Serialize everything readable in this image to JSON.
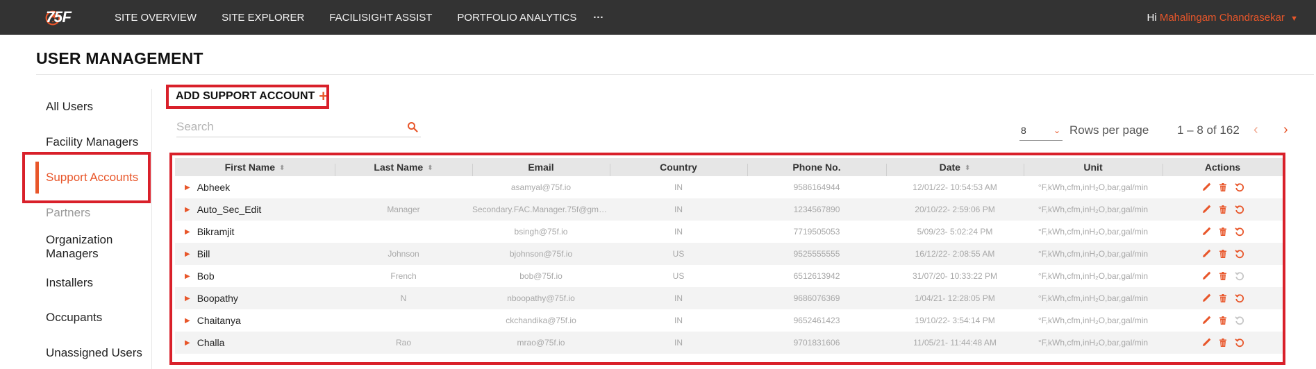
{
  "app": {
    "brand": "75F",
    "nav": [
      "SITE OVERVIEW",
      "SITE EXPLORER",
      "FACILISIGHT ASSIST",
      "PORTFOLIO ANALYTICS"
    ],
    "more": "···",
    "greeting": "Hi",
    "user_name": "Mahalingam Chandrasekar"
  },
  "page": {
    "title": "USER MANAGEMENT"
  },
  "sidebar": {
    "items": [
      "All Users",
      "Facility Managers",
      "Support Accounts",
      "Partners",
      "Organization Managers",
      "Installers",
      "Occupants",
      "Unassigned Users"
    ],
    "active": "Support Accounts"
  },
  "toolbar": {
    "add_label": "ADD SUPPORT ACCOUNT",
    "add_icon": "+",
    "search_placeholder": "Search",
    "rows_value": "8",
    "rows_label": "Rows per page",
    "range_text": "1 – 8 of 162"
  },
  "table": {
    "headers": [
      "First Name",
      "Last Name",
      "Email",
      "Country",
      "Phone No.",
      "Date",
      "Unit",
      "Actions"
    ],
    "rows": [
      {
        "first": "Abheek",
        "last": "",
        "email": "asamyal@75f.io",
        "country": "IN",
        "phone": "9586164944",
        "date": "12/01/22- 10:54:53 AM",
        "unit": "°F,kWh,cfm,inH₂O,bar,gal/min",
        "reset_dim": false
      },
      {
        "first": "Auto_Sec_Edit",
        "last": "Manager",
        "email": "Secondary.FAC.Manager.75f@gma...",
        "country": "IN",
        "phone": "1234567890",
        "date": "20/10/22- 2:59:06 PM",
        "unit": "°F,kWh,cfm,inH₂O,bar,gal/min",
        "reset_dim": false
      },
      {
        "first": "Bikramjit",
        "last": "",
        "email": "bsingh@75f.io",
        "country": "IN",
        "phone": "7719505053",
        "date": "5/09/23- 5:02:24 PM",
        "unit": "°F,kWh,cfm,inH₂O,bar,gal/min",
        "reset_dim": false
      },
      {
        "first": "Bill",
        "last": "Johnson",
        "email": "bjohnson@75f.io",
        "country": "US",
        "phone": "9525555555",
        "date": "16/12/22- 2:08:55 AM",
        "unit": "°F,kWh,cfm,inH₂O,bar,gal/min",
        "reset_dim": false
      },
      {
        "first": "Bob",
        "last": "French",
        "email": "bob@75f.io",
        "country": "US",
        "phone": "6512613942",
        "date": "31/07/20- 10:33:22 PM",
        "unit": "°F,kWh,cfm,inH₂O,bar,gal/min",
        "reset_dim": true
      },
      {
        "first": "Boopathy",
        "last": "N",
        "email": "nboopathy@75f.io",
        "country": "IN",
        "phone": "9686076369",
        "date": "1/04/21- 12:28:05 PM",
        "unit": "°F,kWh,cfm,inH₂O,bar,gal/min",
        "reset_dim": false
      },
      {
        "first": "Chaitanya",
        "last": "",
        "email": "ckchandika@75f.io",
        "country": "IN",
        "phone": "9652461423",
        "date": "19/10/22- 3:54:14 PM",
        "unit": "°F,kWh,cfm,inH₂O,bar,gal/min",
        "reset_dim": true
      },
      {
        "first": "Challa",
        "last": "Rao",
        "email": "mrao@75f.io",
        "country": "IN",
        "phone": "9701831606",
        "date": "11/05/21- 11:44:48 AM",
        "unit": "°F,kWh,cfm,inH₂O,bar,gal/min",
        "reset_dim": false
      }
    ]
  },
  "colors": {
    "accent": "#e8562a",
    "topbar": "#333333",
    "highlight": "#d9202a"
  },
  "icons": {
    "logo": "flame-logo-icon",
    "search": "search-icon",
    "edit": "pencil-icon",
    "delete": "trash-icon",
    "reset": "reset-icon",
    "expand": "triangle-right-icon"
  }
}
